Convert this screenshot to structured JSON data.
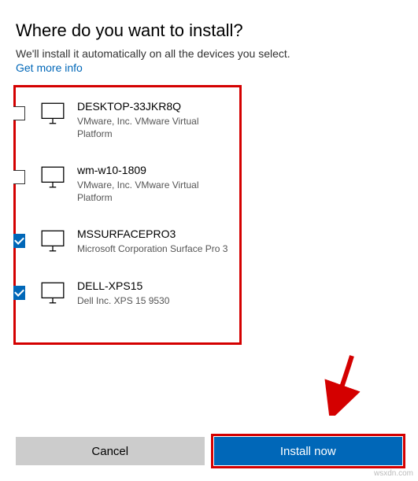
{
  "header": {
    "title": "Where do you want to install?",
    "subtitle": "We'll install it automatically on all the devices you select.",
    "info_link": "Get more info"
  },
  "devices": [
    {
      "name": "DESKTOP-33JKR8Q",
      "desc": "VMware, Inc. VMware Virtual Platform",
      "checked": false
    },
    {
      "name": "wm-w10-1809",
      "desc": "VMware, Inc. VMware Virtual Platform",
      "checked": false
    },
    {
      "name": "MSSURFACEPRO3",
      "desc": "Microsoft Corporation Surface Pro 3",
      "checked": true
    },
    {
      "name": "DELL-XPS15",
      "desc": "Dell Inc. XPS 15 9530",
      "checked": true
    }
  ],
  "buttons": {
    "cancel": "Cancel",
    "install": "Install now"
  },
  "colors": {
    "accent": "#0067b8",
    "highlight": "#d40000"
  },
  "watermark": "wsxdn.com"
}
